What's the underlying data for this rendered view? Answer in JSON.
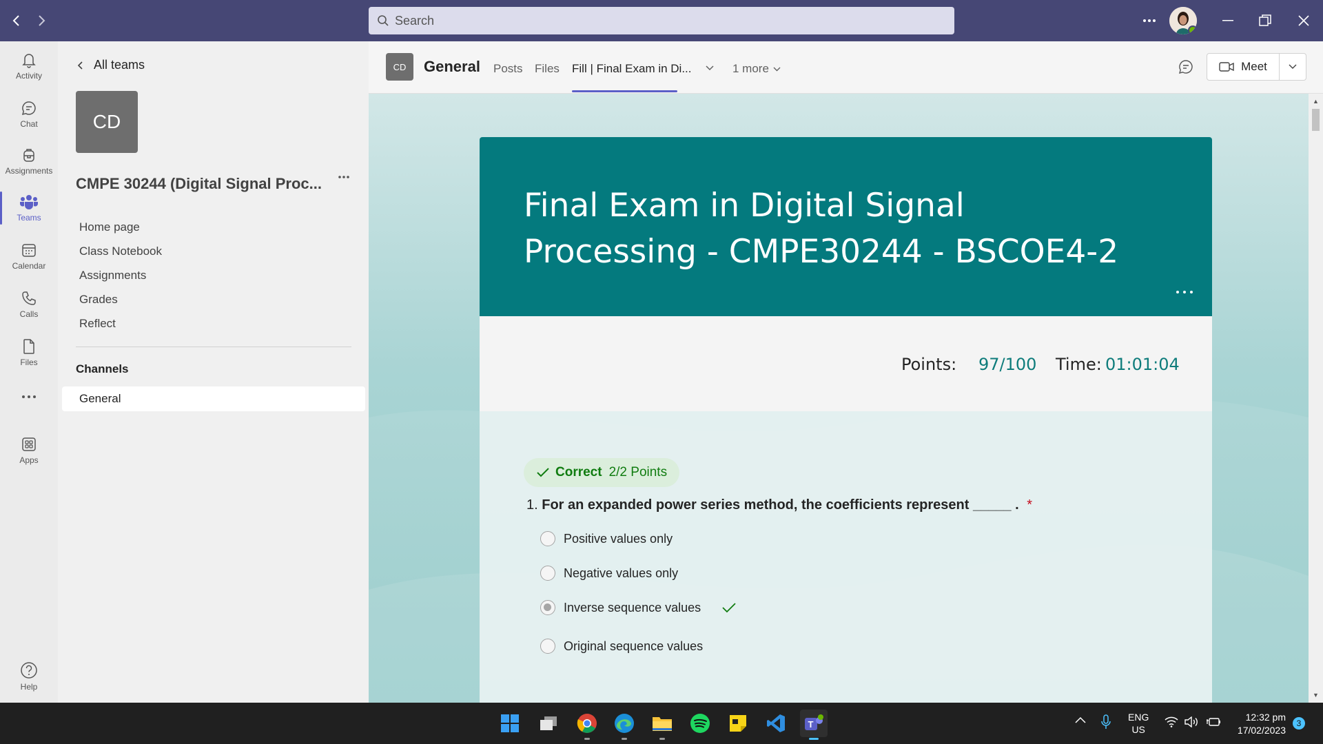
{
  "titlebar": {
    "search_placeholder": "Search"
  },
  "rail": {
    "items": [
      {
        "label": "Activity",
        "icon": "bell-icon"
      },
      {
        "label": "Chat",
        "icon": "chat-icon"
      },
      {
        "label": "Assignments",
        "icon": "backpack-icon"
      },
      {
        "label": "Teams",
        "icon": "teams-icon",
        "active": true
      },
      {
        "label": "Calendar",
        "icon": "calendar-icon"
      },
      {
        "label": "Calls",
        "icon": "phone-icon"
      },
      {
        "label": "Files",
        "icon": "file-icon"
      },
      {
        "label": "Apps",
        "icon": "apps-icon"
      },
      {
        "label": "Help",
        "icon": "help-icon"
      }
    ]
  },
  "team": {
    "back_label": "All teams",
    "avatar_initials": "CD",
    "name": "CMPE 30244 (Digital Signal Proc...",
    "links": [
      "Home page",
      "Class Notebook",
      "Assignments",
      "Grades",
      "Reflect"
    ],
    "channels_heading": "Channels",
    "channels": [
      "General"
    ]
  },
  "channel": {
    "avatar_initials": "CD",
    "title": "General",
    "tabs": [
      "Posts",
      "Files",
      "Fill | Final Exam in Di..."
    ],
    "more_tabs": "1 more",
    "meet_label": "Meet"
  },
  "form": {
    "title": "Final Exam in Digital Signal Processing - CMPE30244 - BSCOE4-2",
    "points_label": "Points:",
    "points_value": "97/100",
    "time_label": "Time:",
    "time_value": "01:01:04",
    "question": {
      "badge_status": "Correct",
      "badge_points": "2/2 Points",
      "number": "1.",
      "text": "For an expanded power series method, the coefficients represent _____ .",
      "required_mark": "*",
      "options": [
        "Positive values only",
        "Negative values only",
        "Inverse sequence values",
        "Original sequence values"
      ],
      "selected_index": 2
    }
  },
  "tray": {
    "lang_line1": "ENG",
    "lang_line2": "US",
    "time": "12:32 pm",
    "date": "17/02/2023",
    "notification_count": "3"
  },
  "colors": {
    "titlebar": "#464775",
    "accent": "#5b5fc7",
    "form_banner": "#047a7e",
    "correct": "#107c10"
  }
}
